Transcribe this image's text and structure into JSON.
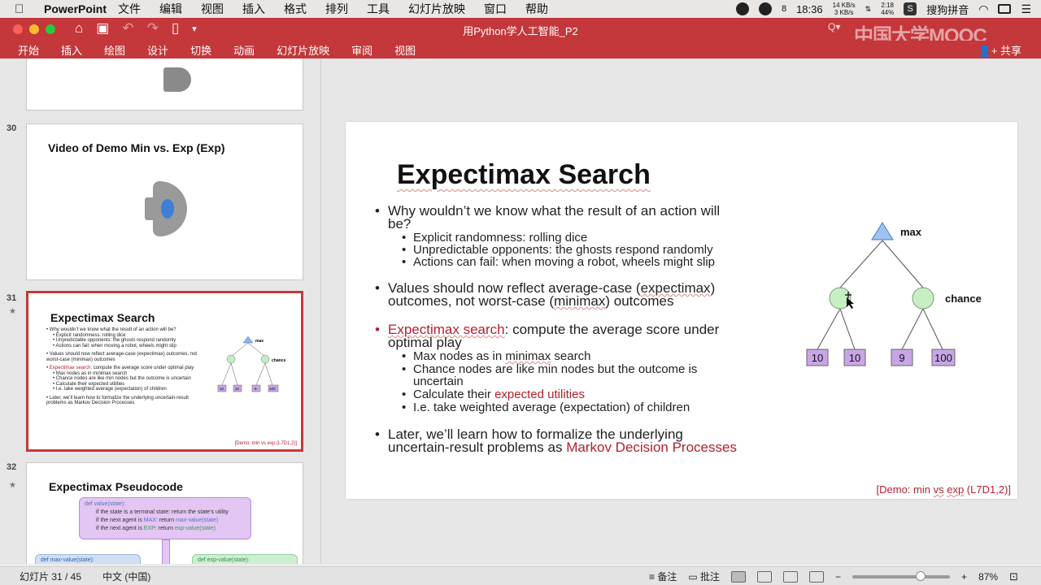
{
  "menubar": {
    "app_name": "PowerPoint",
    "items": [
      "文件",
      "编辑",
      "视图",
      "插入",
      "格式",
      "排列",
      "工具",
      "幻灯片放映",
      "窗口",
      "帮助"
    ],
    "status": {
      "badge": "8",
      "time": "18:36",
      "net_up": "14 KB/s",
      "net_down": "3 KB/s",
      "battery_time": "2:18",
      "battery_pct": "44%",
      "ime": "搜狗拼音"
    }
  },
  "window": {
    "title": "用Python学人工智能_P2",
    "watermark": "中国大学MOOC",
    "search_hint": "Q▾",
    "colors": {
      "close": "#fc5f57",
      "min": "#fdbc2e",
      "max": "#28c840",
      "ribbon": "#c4373a"
    }
  },
  "ribbon": {
    "tabs": [
      "开始",
      "插入",
      "绘图",
      "设计",
      "切换",
      "动画",
      "幻灯片放映",
      "审阅",
      "视图"
    ],
    "share_label": "共享"
  },
  "thumbnails": [
    {
      "number": "30",
      "title": "Video of Demo Min vs. Exp (Exp)"
    },
    {
      "number": "31",
      "title": "Expectimax Search",
      "selected": true
    },
    {
      "number": "32",
      "title": "Expectimax Pseudocode"
    }
  ],
  "thumb31": {
    "b1": "Why wouldn’t we know what the result of an action will be?",
    "s1": "Explicit randomness: rolling dice",
    "s2": "Unpredictable opponents: the ghosts respond randomly",
    "s3": "Actions can fail: when moving a robot, wheels might slip",
    "b2": "Values should now reflect average-case (expectimax) outcomes, not worst-case (minimax) outcomes",
    "b3_red": "Expectimax search:",
    "b3": " compute the average score under optimal play",
    "s4": "Max nodes as in minimax search",
    "s5": "Chance nodes are like min nodes but the outcome is uncertain",
    "s6": "Calculate their expected utilities",
    "s7": "I.e. take weighted average (expectation) of children",
    "b4": "Later, we’ll learn how to formalize the underlying uncertain-result problems as Markov Decision Processes",
    "demo": "[Demo: min vs exp (L7D1,2)]"
  },
  "thumb32": {
    "l1": "def value(state):",
    "l2": "if the state is a terminal state: return the state’s utility",
    "l3a": "if the next agent is ",
    "l3b": "MAX",
    "l3c": ": return ",
    "l3d": "max-value(state)",
    "l4a": "if the next agent is ",
    "l4b": "EXP",
    "l4c": ": return ",
    "l4d": "exp-value(state)",
    "l5": "def max-value(state):",
    "l6": "def exp-value(state):"
  },
  "slide": {
    "title": "Expectimax Search",
    "b1_line1": "Why wouldn’t we know what the result of an action will",
    "b1_line2": "be?",
    "s1": "Explicit randomness: rolling dice",
    "s2": "Unpredictable opponents: the ghosts respond randomly",
    "s3": "Actions can fail: when moving a robot, wheels might slip",
    "b2_line1a": "Values should now reflect average-case (",
    "b2_line1b": "expectimax",
    "b2_line1c": ")",
    "b2_line2a": "outcomes, not worst-case (",
    "b2_line2b": "minimax",
    "b2_line2c": ") outcomes",
    "b3_red": "Expectimax search",
    "b3_line1": ": compute the average score under",
    "b3_line2": "optimal play",
    "s4a": "Max nodes as in ",
    "s4b": "minimax",
    "s4c": " search",
    "s5_line1": "Chance nodes are like min nodes but the outcome is",
    "s5_line2": "uncertain",
    "s6a": "Calculate their ",
    "s6b": "expected utilities",
    "s7": "I.e. take weighted average (expectation) of children",
    "b4_line1": "Later, we’ll learn how to formalize the underlying",
    "b4_line2a": "uncertain-result problems as ",
    "b4_line2b": "Markov Decision Processes",
    "demo_a": "[Demo: min ",
    "demo_b": "vs",
    "demo_c": " ",
    "demo_d": "exp",
    "demo_e": " (L7D1,2)]",
    "tree": {
      "max_label": "max",
      "chance_label": "chance",
      "leaves": [
        "10",
        "10",
        "9",
        "100"
      ]
    }
  },
  "statusbar": {
    "slide_pos": "幻灯片 31 / 45",
    "language": "中文 (中国)",
    "notes": "备注",
    "comments": "批注",
    "zoom": "87%",
    "zoom_fraction": 0.7
  }
}
